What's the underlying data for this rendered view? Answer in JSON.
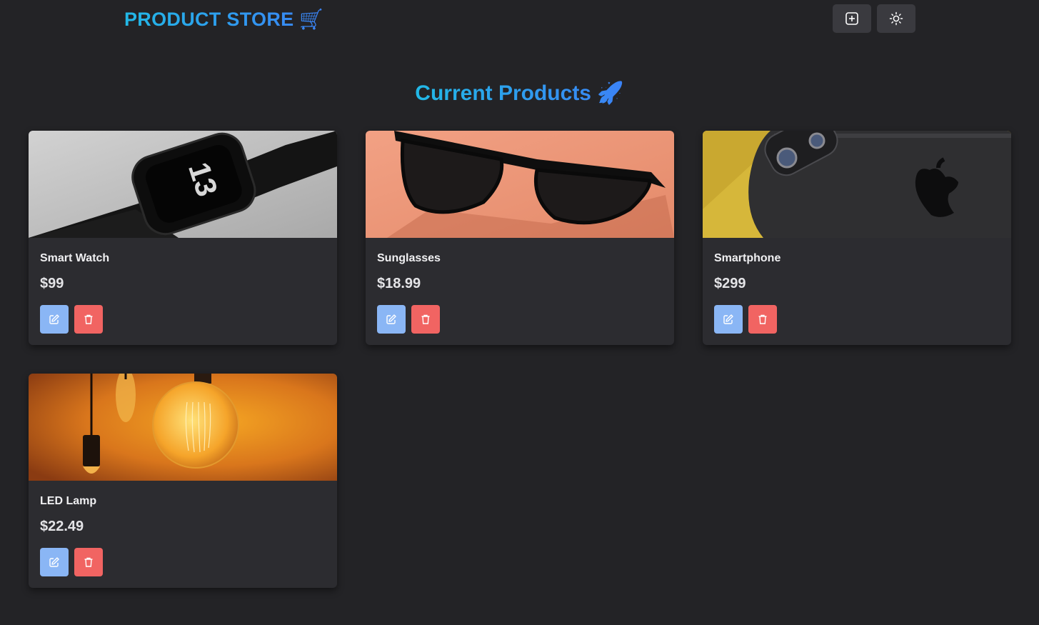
{
  "navbar": {
    "brand": "PRODUCT STORE 🛒",
    "brand_icon": "shopping-cart-icon",
    "create_button_icon": "plus-square-icon",
    "theme_button_icon": "sun-icon"
  },
  "main": {
    "title": "Current Products 🚀",
    "title_icon": "rocket-icon"
  },
  "colors": {
    "background": "#232326",
    "card": "#2c2c30",
    "accent_gradient_start": "#22b8e6",
    "accent_gradient_end": "#3b82f6",
    "edit_button": "#8ab6f5",
    "delete_button": "#f16462"
  },
  "products": [
    {
      "name": "Smart Watch",
      "price": "$99",
      "image": "smart-watch-photo"
    },
    {
      "name": "Sunglasses",
      "price": "$18.99",
      "image": "sunglasses-photo"
    },
    {
      "name": "Smartphone",
      "price": "$299",
      "image": "smartphone-photo"
    },
    {
      "name": "LED Lamp",
      "price": "$22.49",
      "image": "led-lamp-photo"
    }
  ],
  "actions": {
    "edit_icon": "edit-icon",
    "delete_icon": "trash-icon"
  }
}
